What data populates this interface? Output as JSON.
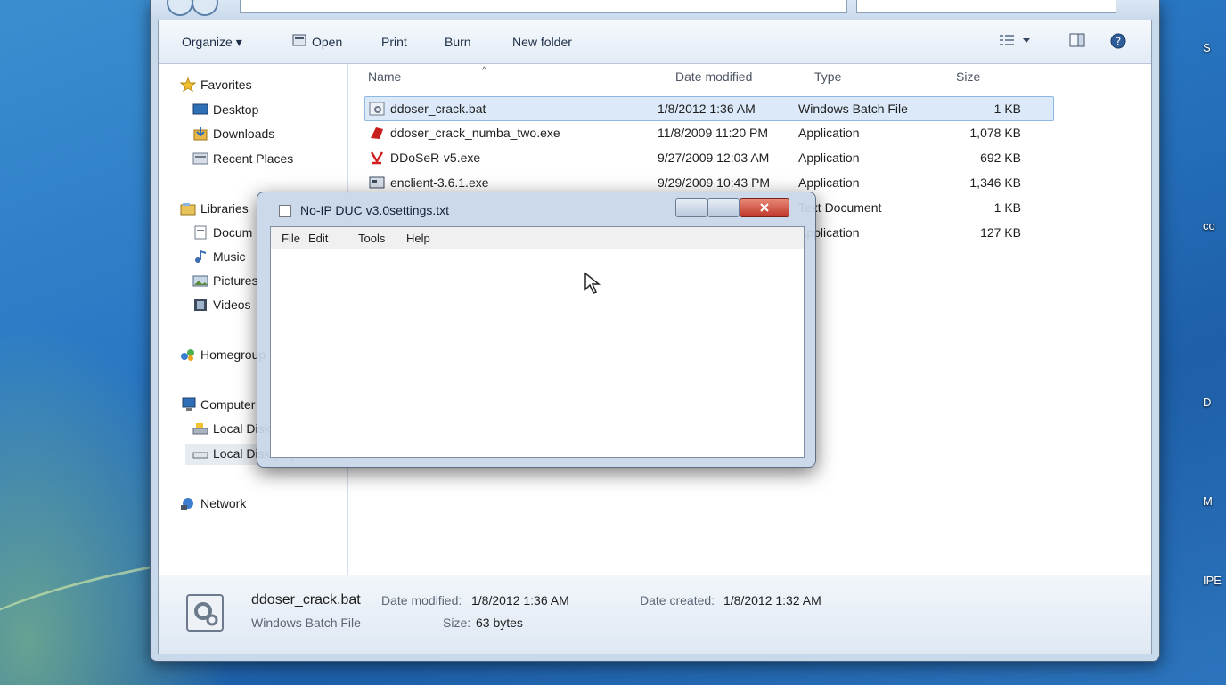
{
  "toolbar": {
    "organize": "Organize ▾",
    "open": "Open",
    "print": "Print",
    "burn": "Burn",
    "new_folder": "New folder"
  },
  "sidebar": {
    "favorites": "Favorites",
    "desktop": "Desktop",
    "downloads": "Downloads",
    "recent_places": "Recent Places",
    "libraries": "Libraries",
    "documents": "Docum",
    "music": "Music",
    "pictures": "Pictures",
    "videos": "Videos",
    "homegroup": "Homegroup",
    "computer": "Computer",
    "local_disk_c": "Local Disk (C:)",
    "local_disk_d": "Local Disk (D:)",
    "network": "Network"
  },
  "columns": {
    "name": "Name",
    "date_modified": "Date modified",
    "type": "Type",
    "size": "Size"
  },
  "files": [
    {
      "name": "ddoser_crack.bat",
      "date": "1/8/2012 1:36 AM",
      "type": "Windows Batch File",
      "size": "1 KB",
      "icon": "batch-file-icon"
    },
    {
      "name": "ddoser_crack_numba_two.exe",
      "date": "11/8/2009 11:20 PM",
      "type": "Application",
      "size": "1,078 KB",
      "icon": "app-red-icon"
    },
    {
      "name": "DDoSeR-v5.exe",
      "date": "9/27/2009 12:03 AM",
      "type": "Application",
      "size": "692 KB",
      "icon": "app-ddos-icon"
    },
    {
      "name": "enclient-3.6.1.exe",
      "date": "9/29/2009 10:43 PM",
      "type": "Application",
      "size": "1,346 KB",
      "icon": "app-window-icon"
    },
    {
      "name": "",
      "date": "",
      "type": "Text Document",
      "size": "1 KB",
      "icon": "text-file-icon"
    },
    {
      "name": "",
      "date": "",
      "type": "Application",
      "size": "127 KB",
      "icon": "app-generic-icon"
    }
  ],
  "details": {
    "filename": "ddoser_crack.bat",
    "filetype": "Windows Batch File",
    "date_modified_label": "Date modified:",
    "date_modified": "1/8/2012 1:36 AM",
    "size_label": "Size:",
    "size": "63 bytes",
    "date_created_label": "Date created:",
    "date_created": "1/8/2012 1:32 AM"
  },
  "notepad": {
    "title": "No-IP DUC v3.0settings.txt",
    "menu": [
      "File",
      "Edit",
      "Tools",
      "Help"
    ]
  },
  "desktop_labels": [
    "S",
    "co",
    "D",
    "M",
    "IPE"
  ],
  "colors": {
    "desktop_blue": "#2a78c4",
    "selection": "#dbe9f8",
    "close_red": "#c0392b"
  }
}
